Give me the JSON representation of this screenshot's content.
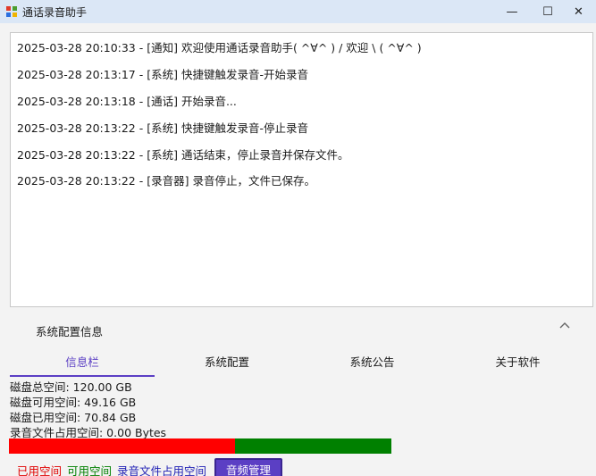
{
  "window": {
    "title": "通话录音助手",
    "minimize_glyph": "—",
    "maximize_glyph": "☐",
    "close_glyph": "✕"
  },
  "log": {
    "lines": [
      "2025-03-28 20:10:33 - [通知] 欢迎使用通话录音助手( ^∀^ )   / 欢迎 \\ ( ^∀^ )",
      "2025-03-28 20:13:17 - [系统] 快捷键触发录音-开始录音",
      "2025-03-28 20:13:18 - [通话] 开始录音...",
      "2025-03-28 20:13:22 - [系统] 快捷键触发录音-停止录音",
      "2025-03-28 20:13:22 - [系统] 通话结束，停止录音并保存文件。",
      "2025-03-28 20:13:22 - [录音器] 录音停止，文件已保存。"
    ]
  },
  "config": {
    "header": "系统配置信息",
    "tabs": [
      "信息栏",
      "系统配置",
      "系统公告",
      "关于软件"
    ],
    "active_tab": 0,
    "info": {
      "total": "磁盘总空间: 120.00 GB",
      "available": "磁盘可用空间: 49.16 GB",
      "used": "磁盘已用空间: 70.84 GB",
      "recordings": "录音文件占用空间: 0.00 Bytes"
    },
    "usage": {
      "used_fraction": 0.59,
      "free_fraction": 0.41,
      "recordings_fraction": 0.0
    },
    "legend": {
      "used": "已用空间",
      "free": "可用空间",
      "recordings": "录音文件占用空间"
    },
    "audio_button": "音频管理"
  },
  "colors": {
    "accent": "#5b3fc4",
    "used": "#ff0000",
    "free": "#008000",
    "recordings": "#1f1fb4"
  },
  "icons": {
    "app": "app-logo-icon",
    "collapse": "chevron-up-icon"
  }
}
